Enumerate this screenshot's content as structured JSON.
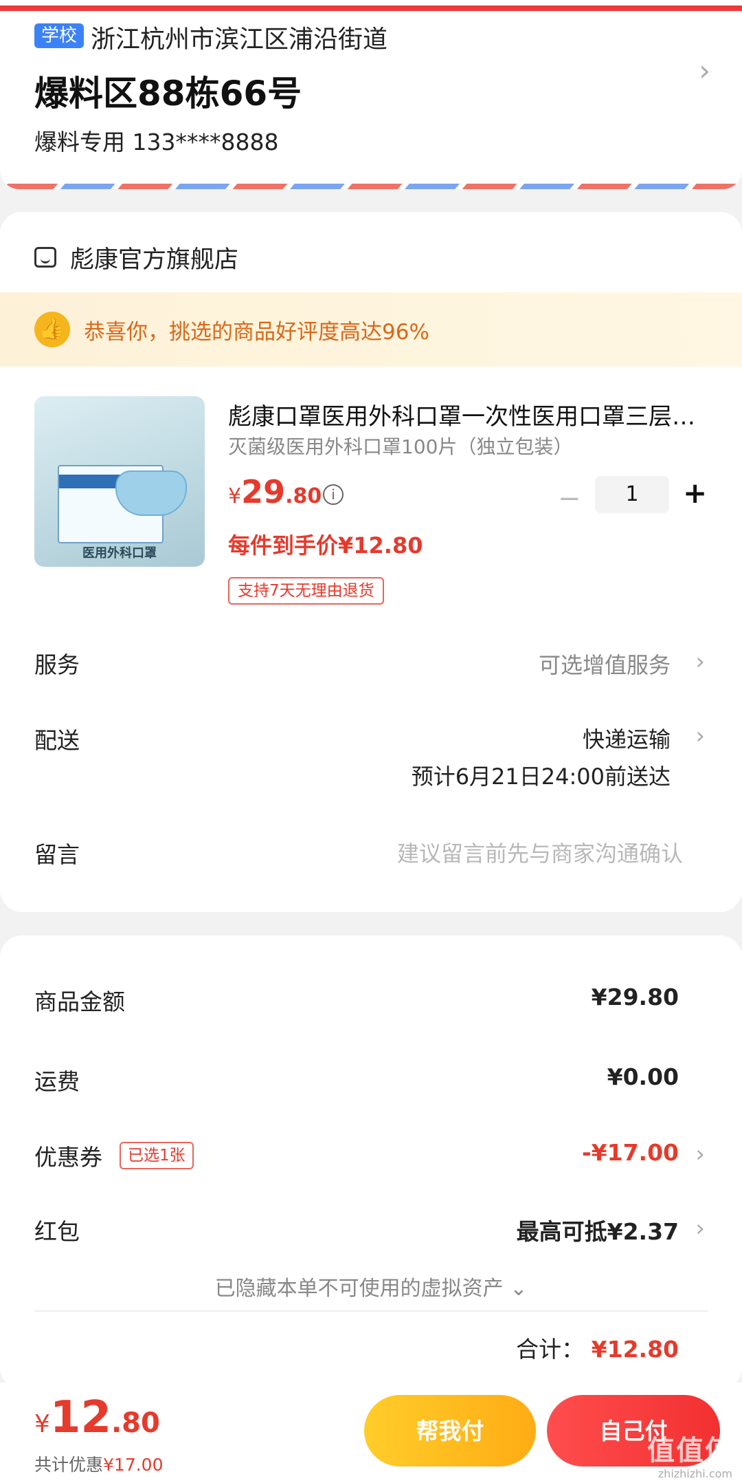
{
  "address": {
    "tag": "学校",
    "region": "浙江杭州市滨江区浦沿街道",
    "detail": "爆料区88栋66号",
    "contact": "爆料专用  133****8888"
  },
  "store": {
    "name": "彪康官方旗舰店",
    "promo": "恭喜你，挑选的商品好评度高达96%"
  },
  "product": {
    "image_caption": "医用外科口罩",
    "title": "彪康口罩医用外科口罩一次性医用口罩三层防护",
    "subtitle": "灭菌级医用外科口罩100片（独立包装）",
    "price_symbol": "¥",
    "price_int": "29",
    "price_dec": ".80",
    "quantity": "1",
    "unit_price": "每件到手价¥12.80",
    "return_policy": "支持7天无理由退货"
  },
  "rows": {
    "service_label": "服务",
    "service_value": "可选增值服务",
    "delivery_label": "配送",
    "delivery_value": "快递运输",
    "delivery_eta": "预计6月21日24:00前送达",
    "message_label": "留言",
    "message_placeholder": "建议留言前先与商家沟通确认"
  },
  "summary": {
    "goods_label": "商品金额",
    "goods_value": "¥29.80",
    "shipping_label": "运费",
    "shipping_value": "¥0.00",
    "coupon_label": "优惠券",
    "coupon_badge": "已选1张",
    "coupon_value": "-¥17.00",
    "redpacket_label": "红包",
    "redpacket_value": "最高可抵¥2.37",
    "hidden_note": "已隐藏本单不可使用的虚拟资产",
    "total_label": "合计：",
    "total_value": "¥12.80"
  },
  "bottom": {
    "price_symbol": "¥",
    "price_int": "12",
    "price_dec": ".80",
    "discount_label": "共计优惠",
    "discount_value": "¥17.00",
    "help_pay": "帮我付",
    "self_pay": "自己付"
  },
  "watermark": {
    "text": "值值值",
    "sub": "zhizhizhi.com"
  }
}
